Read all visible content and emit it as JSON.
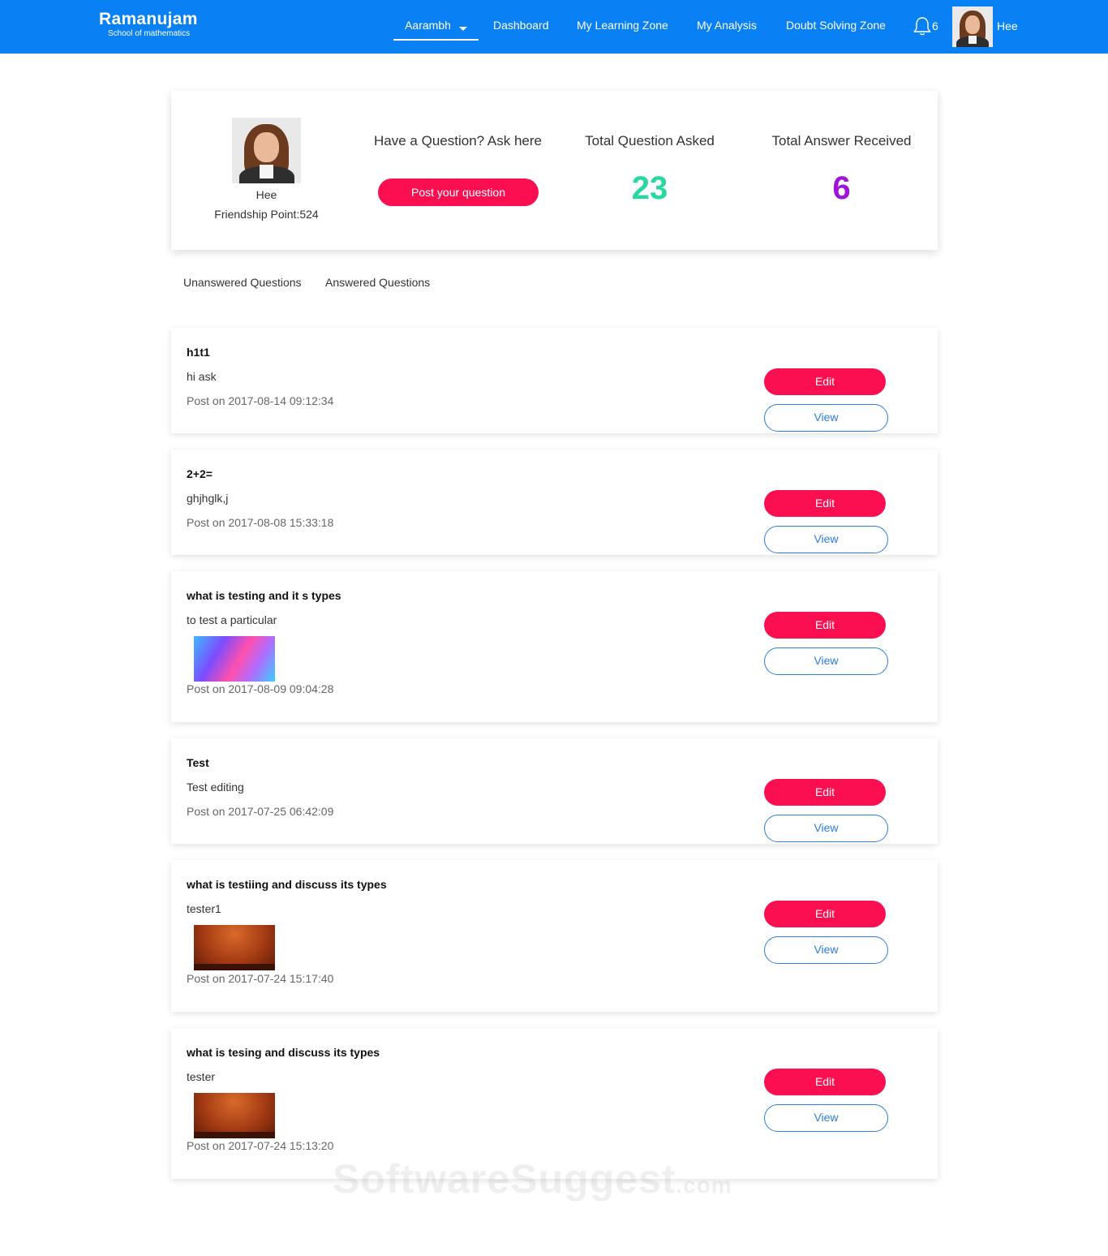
{
  "nav": {
    "logo_title": "Ramanujam",
    "logo_sub": "School of mathematics",
    "items": [
      "Aarambh",
      "Dashboard",
      "My Learning Zone",
      "My Analysis",
      "Doubt Solving Zone"
    ],
    "notification_count": "6",
    "user_name": "Hee"
  },
  "profile": {
    "name": "Hee",
    "friendship_points": "Friendship Point:524",
    "ask_label": "Have a Question? Ask here",
    "post_button": "Post your question",
    "stat_asked_label": "Total Question Asked",
    "stat_asked_value": "23",
    "stat_answer_label": "Total Answer Received",
    "stat_answer_value": "6",
    "colors": {
      "asked": "#27d9a0",
      "answered": "#a013d8",
      "primary_button": "#fb0f51",
      "nav_bg": "#0a80f5"
    }
  },
  "tabs": [
    "Unanswered Questions",
    "Answered Questions"
  ],
  "questions": [
    {
      "title": "h1t1",
      "body": "hi ask",
      "date": "Post on 2017-08-14 09:12:34",
      "edit": "Edit",
      "view": "View"
    },
    {
      "title": "2+2=",
      "body": "ghjhglk,j",
      "date": "Post on 2017-08-08 15:33:18",
      "edit": "Edit",
      "view": "View"
    },
    {
      "title": "what is testing and it s types",
      "body": "to test a particular",
      "date": "Post on 2017-08-09 09:04:28",
      "edit": "Edit",
      "view": "View"
    },
    {
      "title": "Test",
      "body": "Test editing",
      "date": "Post on 2017-07-25 06:42:09",
      "edit": "Edit",
      "view": "View"
    },
    {
      "title": "what is testiing and discuss its types",
      "body": "tester1",
      "date": "Post on 2017-07-24 15:17:40",
      "edit": "Edit",
      "view": "View"
    },
    {
      "title": "what is tesing and discuss its types",
      "body": "tester",
      "date": "Post on 2017-07-24 15:13:20",
      "edit": "Edit",
      "view": "View"
    }
  ],
  "watermark": {
    "main": "SoftwareSuggest",
    "suffix": ".com"
  }
}
